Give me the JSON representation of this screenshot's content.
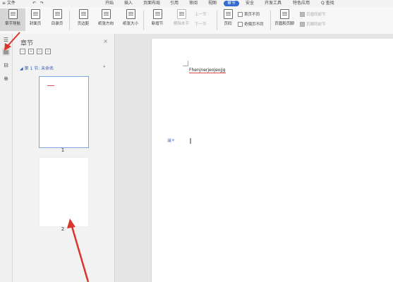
{
  "menubar": {
    "file": "≡ 文件",
    "undo_group": "↶ ↷",
    "items": [
      "开始",
      "插入",
      "页面布局",
      "引用",
      "审阅",
      "视图",
      "章节",
      "安全",
      "开发工具",
      "特色应用"
    ],
    "active_index": 6,
    "search": "Q 查找"
  },
  "ribbon": {
    "buttons": [
      "章节导航",
      "封面页",
      "目录页",
      "页边距",
      "纸张方向",
      "纸张大小",
      "新增节",
      "删除本节",
      "页码",
      "页眉和页脚",
      "页眉同前节"
    ],
    "prev_section": "上一节",
    "next_section": "下一节",
    "header_first": "首页不同",
    "header_oddeven": "奇偶页不同",
    "header_same": "页眉同前节",
    "footer_same": "页脚同前节"
  },
  "nav": {
    "title": "章节",
    "close": "×",
    "section_label": "第 1 节: 未命名",
    "pages": [
      "1",
      "2"
    ]
  },
  "document": {
    "text": "Fhenjnerjeojeojjg"
  },
  "colors": {
    "accent": "#2f6bd0",
    "arrow": "#d9362b"
  }
}
